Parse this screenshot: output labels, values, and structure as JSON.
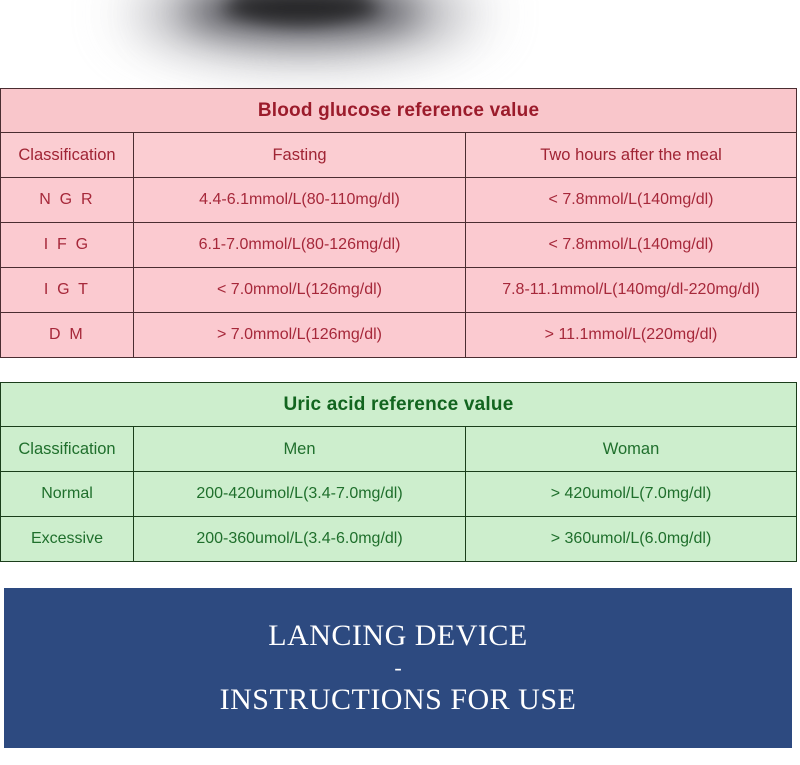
{
  "blood_glucose_table": {
    "title": "Blood glucose reference value",
    "columns": [
      "Classification",
      "Fasting",
      "Two hours after the meal"
    ],
    "rows": [
      {
        "classification": "N G R",
        "fasting": "4.4-6.1mmol/L(80-110mg/dl)",
        "two_hours_after_meal": "< 7.8mmol/L(140mg/dl)"
      },
      {
        "classification": "I F G",
        "fasting": "6.1-7.0mmol/L(80-126mg/dl)",
        "two_hours_after_meal": "< 7.8mmol/L(140mg/dl)"
      },
      {
        "classification": "I G T",
        "fasting": "< 7.0mmol/L(126mg/dl)",
        "two_hours_after_meal": "7.8-11.1mmol/L(140mg/dl-220mg/dl)"
      },
      {
        "classification": "D M",
        "fasting": "> 7.0mmol/L(126mg/dl)",
        "two_hours_after_meal": "> 11.1mmol/L(220mg/dl)"
      }
    ],
    "colors": {
      "background": "#fbcad0",
      "title_background": "#f9c6cb",
      "text": "#a6283a",
      "title_text": "#9b1b2b",
      "border": "#4a2d31"
    }
  },
  "uric_acid_table": {
    "title": "Uric acid reference value",
    "columns": [
      "Classification",
      "Men",
      "Woman"
    ],
    "rows": [
      {
        "classification": "Normal",
        "men": "200-420umol/L(3.4-7.0mg/dl)",
        "woman": "> 420umol/L(7.0mg/dl)"
      },
      {
        "classification": "Excessive",
        "men": "200-360umol/L(3.4-6.0mg/dl)",
        "woman": "> 360umol/L(6.0mg/dl)"
      }
    ],
    "colors": {
      "background": "#cdeecd",
      "text": "#1f6f2c",
      "title_text": "#12651f",
      "border": "#1b3d1b"
    }
  },
  "instructions_banner": {
    "line1": "LANCING DEVICE",
    "separator": "-",
    "line2": "INSTRUCTIONS FOR USE",
    "colors": {
      "background": "#2d4a80",
      "text": "#ffffff"
    }
  }
}
